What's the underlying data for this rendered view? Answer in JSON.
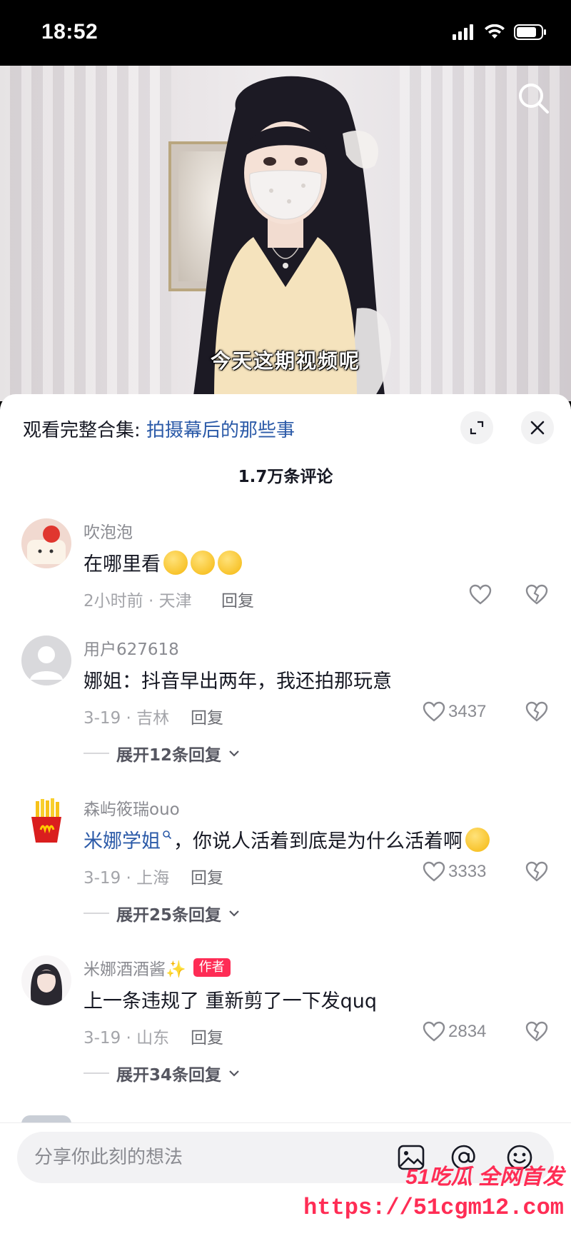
{
  "status_bar": {
    "time": "18:52"
  },
  "video": {
    "subtitle": "今天这期视频呢"
  },
  "sheet": {
    "collection_prefix": "观看完整合集: ",
    "collection_link": "拍摄幕后的那些事",
    "comment_count": "1.7万条评论"
  },
  "comments": [
    {
      "username": "吹泡泡",
      "text": "在哪里看",
      "emojis": [
        "persevering-face",
        "persevering-face",
        "persevering-face"
      ],
      "time_location": "2小时前 · 天津",
      "reply_label": "回复",
      "likes": ""
    },
    {
      "username": "用户627618",
      "text": "娜姐：抖音早出两年，我还拍那玩意",
      "time_location": "3-19 · 吉林",
      "reply_label": "回复",
      "likes": "3437",
      "expand_label": "展开12条回复"
    },
    {
      "username": "森屿筱瑞ouo",
      "mention": "米娜学姐",
      "text": "，你说人活着到底是为什么活着啊",
      "emojis": [
        "crying-face"
      ],
      "time_location": "3-19 · 上海",
      "reply_label": "回复",
      "likes": "3333",
      "expand_label": "展开25条回复"
    },
    {
      "username": "米娜酒酒酱✨",
      "author_badge": "作者",
      "text": "上一条违规了 重新剪了一下发quq",
      "time_location": "3-19 · 山东",
      "reply_label": "回复",
      "likes": "2834",
      "expand_label": "展开34条回复"
    }
  ],
  "input_bar": {
    "placeholder": "分享你此刻的想法",
    "icons": [
      "image-icon",
      "at-icon",
      "emoji-icon"
    ]
  },
  "watermark": {
    "brand": "51吃瓜 全网首发",
    "url": "https://51cgm12.com"
  },
  "colors": {
    "link": "#2b5aa8",
    "accent": "#fe2c55"
  }
}
